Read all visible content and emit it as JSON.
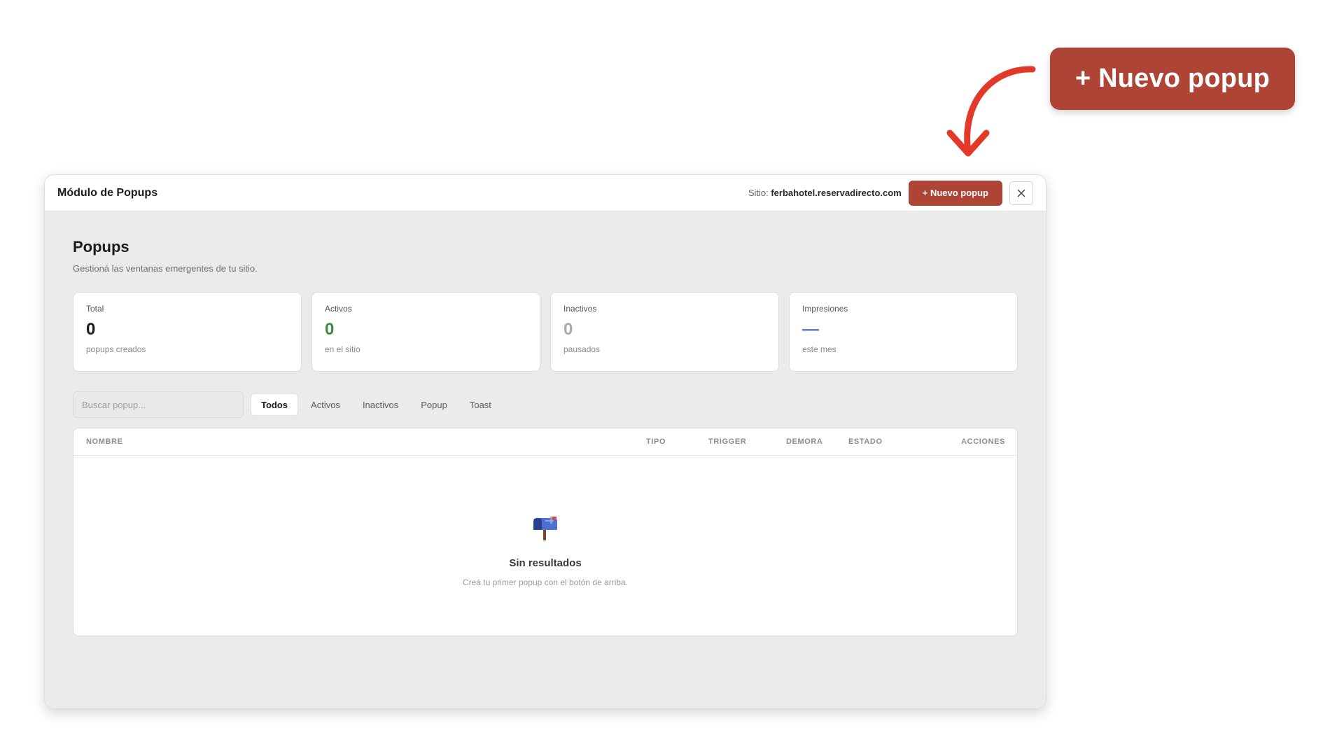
{
  "callout": {
    "button_label": "+ Nuevo popup",
    "accent": "#ad4435",
    "arrow_color": "#e3392b"
  },
  "modal": {
    "title": "Módulo de Popups",
    "site_prefix": "Sitio:",
    "site_value": "ferbahotel.reservadirecto.com",
    "new_button_label": "+ Nuevo popup",
    "close_icon": "close-icon"
  },
  "page": {
    "title": "Popups",
    "subtitle": "Gestioná las ventanas emergentes de tu sitio."
  },
  "stats": [
    {
      "label": "Total",
      "value": "0",
      "note": "popups creados",
      "color": "#1c1c1c"
    },
    {
      "label": "Activos",
      "value": "0",
      "note": "en el sitio",
      "color": "#3f8a46"
    },
    {
      "label": "Inactivos",
      "value": "0",
      "note": "pausados",
      "color": "#a9a9a9"
    },
    {
      "label": "Impresiones",
      "value": "—",
      "note": "este mes",
      "color": "#4f78b0"
    }
  ],
  "filters": {
    "search_placeholder": "Buscar popup...",
    "tabs": [
      {
        "label": "Todos",
        "active": true
      },
      {
        "label": "Activos",
        "active": false
      },
      {
        "label": "Inactivos",
        "active": false
      },
      {
        "label": "Popup",
        "active": false
      },
      {
        "label": "Toast",
        "active": false
      }
    ]
  },
  "table": {
    "columns": [
      "NOMBRE",
      "TIPO",
      "TRIGGER",
      "DEMORA",
      "ESTADO",
      "ACCIONES"
    ],
    "rows": [],
    "empty_icon": "mailbox-icon",
    "empty_title": "Sin resultados",
    "empty_desc": "Creá tu primer popup con el botón de arriba."
  }
}
